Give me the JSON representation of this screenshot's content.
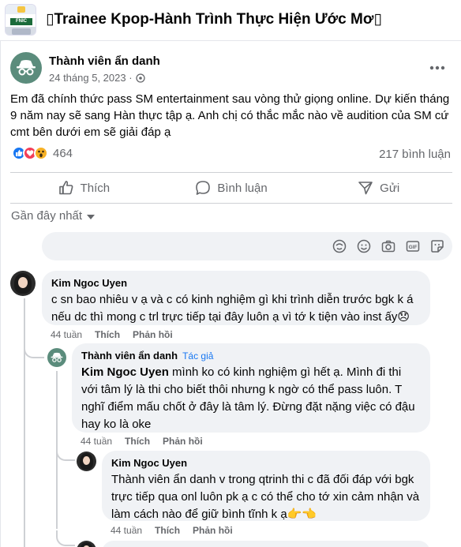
{
  "group": {
    "title": "▯Trainee Kpop-Hành Trình Thực Hiện Ước Mơ▯",
    "thumb_text": "FNIC"
  },
  "post": {
    "author": "Thành viên ẩn danh",
    "date": "24 tháng 5, 2023 · ",
    "text": "Em đã chính thức pass SM entertainment sau vòng thử giọng online. Dự kiến tháng 9 năm nay sẽ sang Hàn thực tập ạ. Anh chị có thắc mắc nào về audition của SM cứ cmt bên dưới em sẽ giải đáp ạ",
    "reaction_count": "464",
    "comment_count": "217 bình luận"
  },
  "actions": {
    "like": "Thích",
    "comment": "Bình luận",
    "send": "Gửi"
  },
  "sort_label": "Gần đây nhất",
  "comments": [
    {
      "name": "Kim Ngoc Uyen",
      "text": "c sn bao nhiêu v ạ và c có kinh nghiệm gì khi trình diễn trước bgk k á nếu dc thì mong c trl trực tiếp tại đây luôn ạ vì tớ k tiện vào inst ấy😞",
      "time": "44 tuần",
      "like": "Thích",
      "reply": "Phản hồi"
    },
    {
      "name": "Thành viên ẩn danh",
      "badge": "Tác giả",
      "mention": "Kim Ngoc Uyen",
      "text": " mình ko có kinh nghiệm gì hết ạ. Mình đi thi với tâm lý là thi cho biết thôi nhưng k ngờ có thể pass luôn. T nghĩ điểm mấu chốt ở đây là tâm lý. Đừng đặt nặng việc có đậu hay ko là oke",
      "time": "44 tuần",
      "like": "Thích",
      "reply": "Phản hồi"
    },
    {
      "name": "Kim Ngoc Uyen",
      "text": "Thành viên ẩn danh v trong qtrinh thi c đã đối đáp với bgk trực tiếp qua onl luôn pk ạ c có thể cho tớ xin cảm nhận và làm cách nào để giữ bình tĩnh k ạ👉👈",
      "time": "44 tuần",
      "like": "Thích",
      "reply": "Phản hồi"
    }
  ],
  "icons": {
    "more": "more-icon",
    "globe": "globe-icon",
    "like": "thumbs-up-icon",
    "comment": "comment-bubble-icon",
    "send": "send-icon",
    "sticker": "sticker-icon",
    "emoji": "emoji-icon",
    "camera": "camera-icon",
    "gif": "gif-icon",
    "stickers2": "sticker-square-icon"
  },
  "colors": {
    "accent": "#1877f2",
    "secondary_text": "#65676b",
    "bubble": "#f0f2f5"
  }
}
